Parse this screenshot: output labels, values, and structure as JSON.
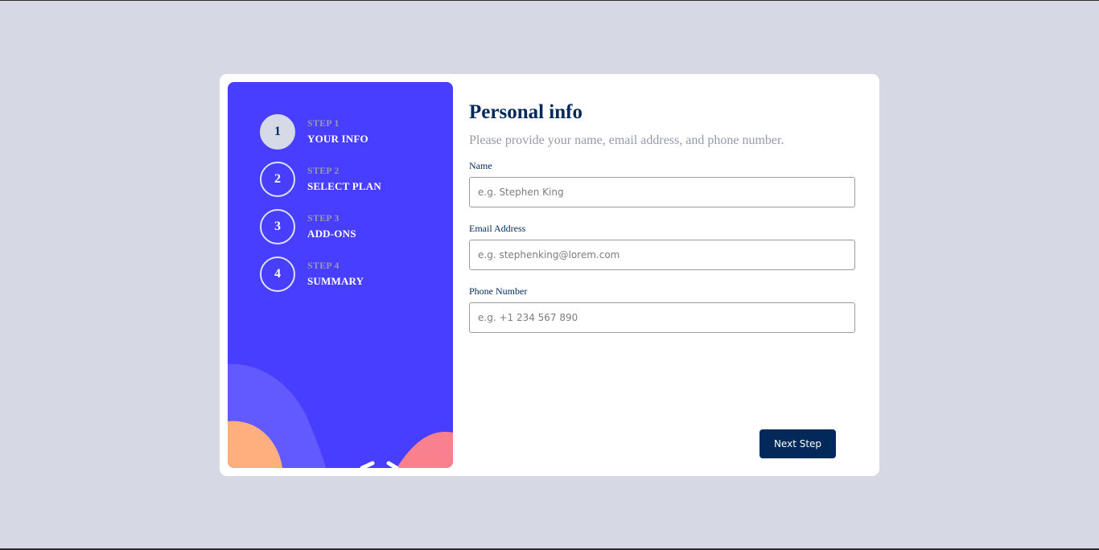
{
  "colors": {
    "page_background": "#d6d9e4",
    "sidebar_background": "#483eff",
    "primary_dark": "#02295a",
    "muted_text": "#9699ab",
    "active_step_fill": "#d6d9e6"
  },
  "sidebar": {
    "steps": [
      {
        "number": "1",
        "label": "STEP 1",
        "title": "YOUR INFO",
        "active": true
      },
      {
        "number": "2",
        "label": "STEP 2",
        "title": "SELECT PLAN",
        "active": false
      },
      {
        "number": "3",
        "label": "STEP 3",
        "title": "ADD-ONS",
        "active": false
      },
      {
        "number": "4",
        "label": "STEP 4",
        "title": "SUMMARY",
        "active": false
      }
    ]
  },
  "form": {
    "title": "Personal info",
    "subtitle": "Please provide your name, email address, and phone number.",
    "fields": {
      "name": {
        "label": "Name",
        "placeholder": "e.g. Stephen King",
        "value": ""
      },
      "email": {
        "label": "Email Address",
        "placeholder": "e.g. stephenking@lorem.com",
        "value": ""
      },
      "phone": {
        "label": "Phone Number",
        "placeholder": "e.g. +1 234 567 890",
        "value": ""
      }
    },
    "next_label": "Next Step"
  }
}
